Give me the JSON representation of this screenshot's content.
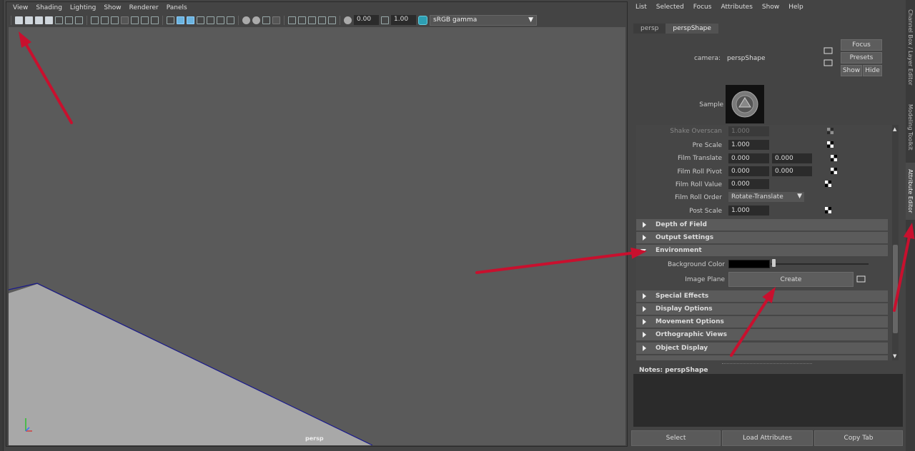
{
  "viewport": {
    "menu": [
      "View",
      "Shading",
      "Lighting",
      "Show",
      "Renderer",
      "Panels"
    ],
    "exposure": "0.00",
    "gamma": "1.00",
    "color_space": "sRGB gamma",
    "camera_label": "persp"
  },
  "attribute_editor": {
    "menu": [
      "List",
      "Selected",
      "Focus",
      "Attributes",
      "Show",
      "Help"
    ],
    "tabs": [
      "persp",
      "perspShape"
    ],
    "active_tab": "perspShape",
    "camera_label": "camera:",
    "camera_value": "perspShape",
    "focus_button": "Focus",
    "presets_button": "Presets",
    "show_button": "Show",
    "hide_button": "Hide",
    "sample_label": "Sample",
    "rows": {
      "shake_overscan": {
        "label": "Shake Overscan",
        "value": "1.000"
      },
      "pre_scale": {
        "label": "Pre Scale",
        "value": "1.000"
      },
      "film_translate": {
        "label": "Film Translate",
        "value1": "0.000",
        "value2": "0.000"
      },
      "film_roll_pivot": {
        "label": "Film Roll Pivot",
        "value1": "0.000",
        "value2": "0.000"
      },
      "film_roll_value": {
        "label": "Film Roll Value",
        "value": "0.000"
      },
      "film_roll_order": {
        "label": "Film Roll Order",
        "value": "Rotate-Translate"
      },
      "post_scale": {
        "label": "Post Scale",
        "value": "1.000"
      }
    },
    "sections_top": [
      "Depth of Field",
      "Output Settings"
    ],
    "environment": {
      "title": "Environment",
      "background_color_label": "Background Color",
      "background_color": "#000000",
      "image_plane_label": "Image Plane",
      "create_button": "Create"
    },
    "sections_bottom": [
      "Special Effects",
      "Display Options",
      "Movement Options",
      "Orthographic Views",
      "Object Display"
    ],
    "notes_label": "Notes:  perspShape",
    "bottom_buttons": [
      "Select",
      "Load Attributes",
      "Copy Tab"
    ]
  },
  "side_tabs": [
    "Channel Box / Layer Editor",
    "Modeling Toolkit",
    "Attribute Editor"
  ],
  "annotation_color": "#c8102e"
}
